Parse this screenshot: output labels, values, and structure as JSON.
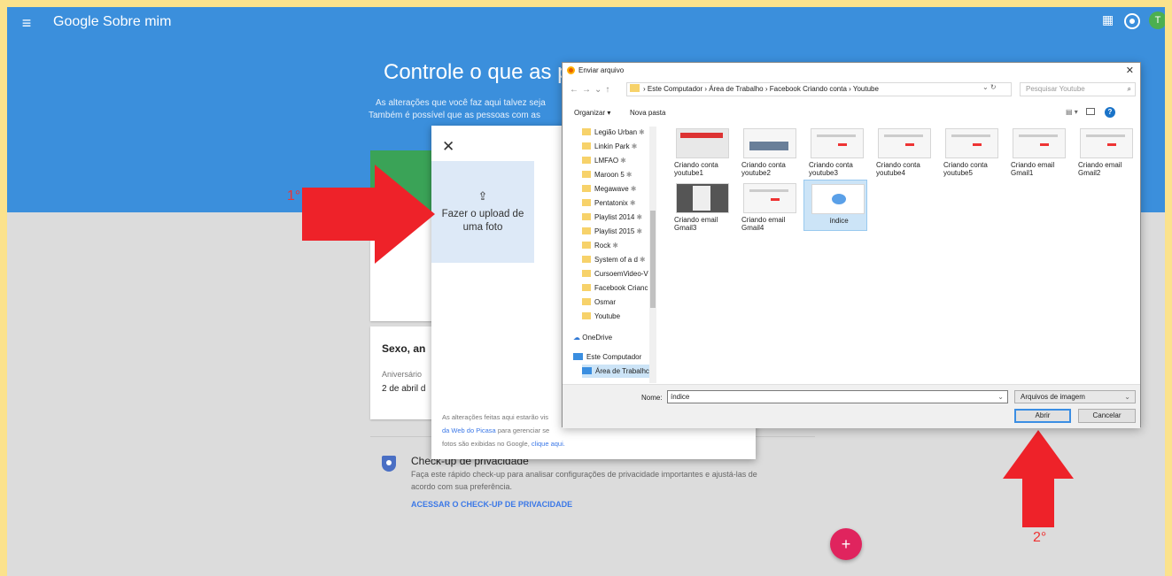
{
  "header": {
    "brand": "Google",
    "product": "Sobre mim",
    "avatar_letter": "T"
  },
  "hero": {
    "headline": "Controle o que as p",
    "sub1": "As alterações que você faz aqui talvez seja",
    "sub2": "Também é possível que as pessoas com as"
  },
  "profile_card": {
    "title": "Sexo, an",
    "field_label": "Aniversário",
    "field_value": "2 de abril d"
  },
  "privacy": {
    "title": "Check-up de privacidade",
    "desc1": "Faça este rápido check-up para analisar configurações de privacidade importantes e ajustá-las de",
    "desc2": "acordo com sua preferência.",
    "link": "ACESSAR O CHECK-UP DE PRIVACIDADE"
  },
  "fab_label": "+",
  "upload_dialog": {
    "close": "✕",
    "upload_icon": "⇪",
    "upload_label": "Fazer o upload de uma foto",
    "footer1": "As alterações feitas aqui estarão vis",
    "footer2_link": "da Web do Picasa",
    "footer2_rest": " para gerenciar se",
    "footer3_pre": "fotos são exibidas no Google, ",
    "footer3_link": "clique aqui."
  },
  "annotations": {
    "step1": "1°",
    "step2": "2°",
    "arrow_color": "#ee2229"
  },
  "file_dialog": {
    "title": "Enviar arquivo",
    "breadcrumb": [
      "Este Computador",
      "Área de Trabalho",
      "Facebook Criando conta",
      "Youtube"
    ],
    "path_text": "›  Este Computador  ›  Área de Trabalho  ›  Facebook Criando conta  ›  Youtube",
    "search_placeholder": "Pesquisar Youtube",
    "toolbar": {
      "organize": "Organizar ▾",
      "new_folder": "Nova pasta"
    },
    "tree": [
      {
        "label": "Legião Urban"
      },
      {
        "label": "Linkin Park"
      },
      {
        "label": "LMFAO"
      },
      {
        "label": "Maroon 5"
      },
      {
        "label": "Megawave"
      },
      {
        "label": "Pentatonix"
      },
      {
        "label": "Playlist 2014"
      },
      {
        "label": "Playlist 2015"
      },
      {
        "label": "Rock"
      },
      {
        "label": "System of a d"
      },
      {
        "label": "CursoemVideo-V"
      },
      {
        "label": "Facebook Crianc"
      },
      {
        "label": "Osmar"
      },
      {
        "label": "Youtube"
      },
      {
        "label": "OneDrive"
      },
      {
        "label": "Este Computador"
      },
      {
        "label": "Área de Trabalhc"
      }
    ],
    "files": [
      {
        "name": "Criando conta youtube1"
      },
      {
        "name": "Criando conta youtube2"
      },
      {
        "name": "Criando conta youtube3"
      },
      {
        "name": "Criando conta youtube4"
      },
      {
        "name": "Criando conta youtube5"
      },
      {
        "name": "Criando email Gmail1"
      },
      {
        "name": "Criando email Gmail2"
      },
      {
        "name": "Criando email Gmail3"
      },
      {
        "name": "Criando email Gmail4"
      },
      {
        "name": "índice"
      }
    ],
    "filename_label": "Nome:",
    "filename_value": "índice",
    "filetype": "Arquivos de imagem",
    "open_button": "Abrir",
    "cancel_button": "Cancelar"
  }
}
